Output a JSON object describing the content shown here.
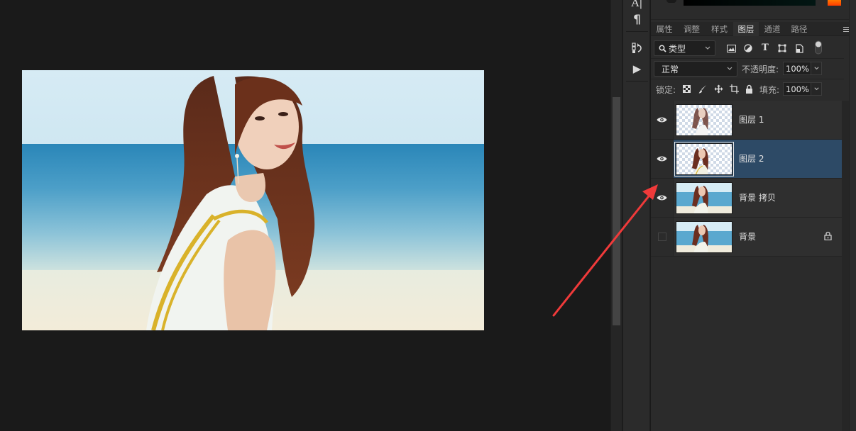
{
  "app": "Photoshop",
  "canvas": {
    "image_description": "Woman with long auburn hair in white sleeveless top with yellow stripes on a beach, blue sea and pale sky"
  },
  "tool_strip": {
    "items": [
      {
        "name": "character-panel",
        "icon": "character-icon"
      },
      {
        "name": "paragraph-panel",
        "icon": "paragraph-icon",
        "glyph": "¶"
      },
      {
        "name": "history-panel",
        "icon": "history-icon"
      },
      {
        "name": "actions-panel",
        "icon": "play-icon",
        "glyph": "▶"
      }
    ]
  },
  "panel": {
    "tabs": [
      {
        "label": "属性",
        "active": false
      },
      {
        "label": "调整",
        "active": false
      },
      {
        "label": "样式",
        "active": false
      },
      {
        "label": "图层",
        "active": true
      },
      {
        "label": "通道",
        "active": false
      },
      {
        "label": "路径",
        "active": false
      }
    ],
    "filter": {
      "kind_label": "类型",
      "filter_icons": [
        "image-filter-icon",
        "adjustment-filter-icon",
        "type-filter-icon",
        "shape-filter-icon",
        "smart-object-filter-icon",
        "filter-toggle-icon"
      ],
      "type_glyph": "T"
    },
    "blend": {
      "mode": "正常",
      "opacity_label": "不透明度:",
      "opacity_value": "100%"
    },
    "lock": {
      "label": "锁定:",
      "icons": [
        "lock-transparent-pixels-icon",
        "lock-image-pixels-icon",
        "lock-position-icon",
        "lock-artboard-icon",
        "lock-all-icon"
      ],
      "fill_label": "填充:",
      "fill_value": "100%"
    },
    "layers": [
      {
        "name": "图层 1",
        "visible": true,
        "selected": false,
        "transparent": true,
        "locked": false
      },
      {
        "name": "图层 2",
        "visible": true,
        "selected": true,
        "transparent": true,
        "locked": false
      },
      {
        "name": "背景 拷贝",
        "visible": true,
        "selected": false,
        "transparent": false,
        "locked": false
      },
      {
        "name": "背景",
        "visible": false,
        "selected": false,
        "transparent": false,
        "locked": true
      }
    ]
  },
  "annotation": {
    "type": "arrow",
    "color": "#ff3b3b",
    "points_to": "图层 2 visibility / layer row"
  },
  "colors": {
    "selected_layer": "#2d4a66",
    "panel_bg": "#2b2b2b",
    "workspace_bg": "#1a1a1a",
    "foreground_swatch": "#ff5a00"
  }
}
